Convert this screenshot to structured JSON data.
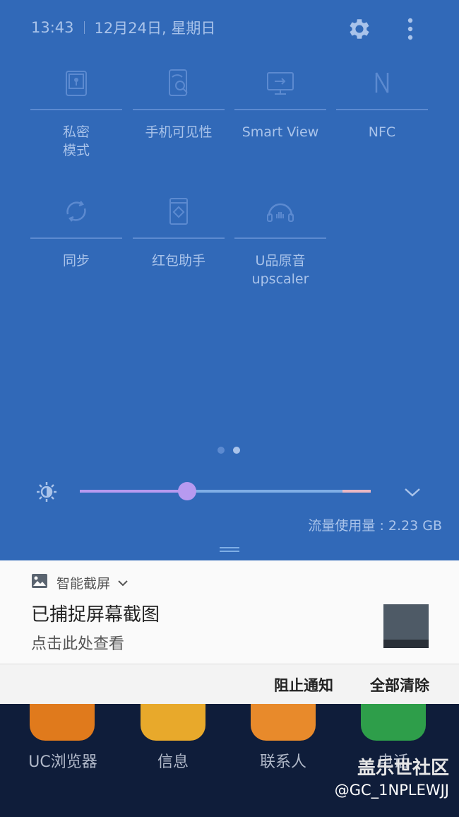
{
  "status": {
    "time": "13:43",
    "date": "12月24日, 星期日"
  },
  "tiles": [
    {
      "label": "私密\n模式",
      "icon": "private-mode-icon"
    },
    {
      "label": "手机可见性",
      "icon": "phone-visibility-icon"
    },
    {
      "label": "Smart View",
      "icon": "smart-view-icon"
    },
    {
      "label": "NFC",
      "icon": "nfc-icon"
    },
    {
      "label": "同步",
      "icon": "sync-icon"
    },
    {
      "label": "红包助手",
      "icon": "red-envelope-icon"
    },
    {
      "label": "U品原音\nupscaler",
      "icon": "upscaler-icon"
    }
  ],
  "brightness": {
    "level_fraction": 0.37
  },
  "data_usage": "流量使用量 : 2.23 GB",
  "notification": {
    "app_name": "智能截屏",
    "title": "已捕捉屏幕截图",
    "text": "点击此处查看"
  },
  "actions": {
    "block": "阻止通知",
    "clear_all": "全部清除"
  },
  "home_apps": [
    {
      "label": "UC浏览器",
      "color": "#e07a1c"
    },
    {
      "label": "信息",
      "color": "#e8a92b"
    },
    {
      "label": "联系人",
      "color": "#e88a2b"
    },
    {
      "label": "电话",
      "color": "#2e9e4a"
    }
  ],
  "watermark": {
    "site": "盖乐世社区",
    "user": "@GC_1NPLEWJJ"
  },
  "colors": {
    "panel": "#3169b8",
    "accent": "#b79af0",
    "muted_text": "#a9c3ea"
  }
}
